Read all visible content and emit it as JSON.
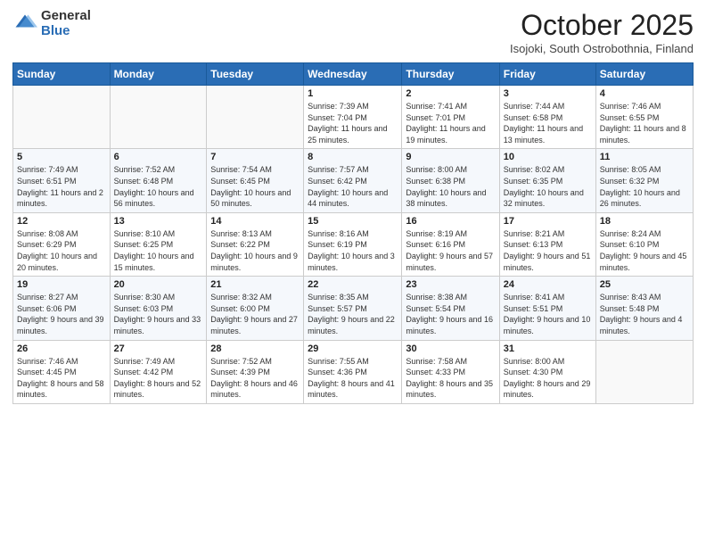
{
  "logo": {
    "general": "General",
    "blue": "Blue"
  },
  "header": {
    "month": "October 2025",
    "location": "Isojoki, South Ostrobothnia, Finland"
  },
  "weekdays": [
    "Sunday",
    "Monday",
    "Tuesday",
    "Wednesday",
    "Thursday",
    "Friday",
    "Saturday"
  ],
  "weeks": [
    [
      {
        "day": "",
        "sunrise": "",
        "sunset": "",
        "daylight": ""
      },
      {
        "day": "",
        "sunrise": "",
        "sunset": "",
        "daylight": ""
      },
      {
        "day": "",
        "sunrise": "",
        "sunset": "",
        "daylight": ""
      },
      {
        "day": "1",
        "sunrise": "Sunrise: 7:39 AM",
        "sunset": "Sunset: 7:04 PM",
        "daylight": "Daylight: 11 hours and 25 minutes."
      },
      {
        "day": "2",
        "sunrise": "Sunrise: 7:41 AM",
        "sunset": "Sunset: 7:01 PM",
        "daylight": "Daylight: 11 hours and 19 minutes."
      },
      {
        "day": "3",
        "sunrise": "Sunrise: 7:44 AM",
        "sunset": "Sunset: 6:58 PM",
        "daylight": "Daylight: 11 hours and 13 minutes."
      },
      {
        "day": "4",
        "sunrise": "Sunrise: 7:46 AM",
        "sunset": "Sunset: 6:55 PM",
        "daylight": "Daylight: 11 hours and 8 minutes."
      }
    ],
    [
      {
        "day": "5",
        "sunrise": "Sunrise: 7:49 AM",
        "sunset": "Sunset: 6:51 PM",
        "daylight": "Daylight: 11 hours and 2 minutes."
      },
      {
        "day": "6",
        "sunrise": "Sunrise: 7:52 AM",
        "sunset": "Sunset: 6:48 PM",
        "daylight": "Daylight: 10 hours and 56 minutes."
      },
      {
        "day": "7",
        "sunrise": "Sunrise: 7:54 AM",
        "sunset": "Sunset: 6:45 PM",
        "daylight": "Daylight: 10 hours and 50 minutes."
      },
      {
        "day": "8",
        "sunrise": "Sunrise: 7:57 AM",
        "sunset": "Sunset: 6:42 PM",
        "daylight": "Daylight: 10 hours and 44 minutes."
      },
      {
        "day": "9",
        "sunrise": "Sunrise: 8:00 AM",
        "sunset": "Sunset: 6:38 PM",
        "daylight": "Daylight: 10 hours and 38 minutes."
      },
      {
        "day": "10",
        "sunrise": "Sunrise: 8:02 AM",
        "sunset": "Sunset: 6:35 PM",
        "daylight": "Daylight: 10 hours and 32 minutes."
      },
      {
        "day": "11",
        "sunrise": "Sunrise: 8:05 AM",
        "sunset": "Sunset: 6:32 PM",
        "daylight": "Daylight: 10 hours and 26 minutes."
      }
    ],
    [
      {
        "day": "12",
        "sunrise": "Sunrise: 8:08 AM",
        "sunset": "Sunset: 6:29 PM",
        "daylight": "Daylight: 10 hours and 20 minutes."
      },
      {
        "day": "13",
        "sunrise": "Sunrise: 8:10 AM",
        "sunset": "Sunset: 6:25 PM",
        "daylight": "Daylight: 10 hours and 15 minutes."
      },
      {
        "day": "14",
        "sunrise": "Sunrise: 8:13 AM",
        "sunset": "Sunset: 6:22 PM",
        "daylight": "Daylight: 10 hours and 9 minutes."
      },
      {
        "day": "15",
        "sunrise": "Sunrise: 8:16 AM",
        "sunset": "Sunset: 6:19 PM",
        "daylight": "Daylight: 10 hours and 3 minutes."
      },
      {
        "day": "16",
        "sunrise": "Sunrise: 8:19 AM",
        "sunset": "Sunset: 6:16 PM",
        "daylight": "Daylight: 9 hours and 57 minutes."
      },
      {
        "day": "17",
        "sunrise": "Sunrise: 8:21 AM",
        "sunset": "Sunset: 6:13 PM",
        "daylight": "Daylight: 9 hours and 51 minutes."
      },
      {
        "day": "18",
        "sunrise": "Sunrise: 8:24 AM",
        "sunset": "Sunset: 6:10 PM",
        "daylight": "Daylight: 9 hours and 45 minutes."
      }
    ],
    [
      {
        "day": "19",
        "sunrise": "Sunrise: 8:27 AM",
        "sunset": "Sunset: 6:06 PM",
        "daylight": "Daylight: 9 hours and 39 minutes."
      },
      {
        "day": "20",
        "sunrise": "Sunrise: 8:30 AM",
        "sunset": "Sunset: 6:03 PM",
        "daylight": "Daylight: 9 hours and 33 minutes."
      },
      {
        "day": "21",
        "sunrise": "Sunrise: 8:32 AM",
        "sunset": "Sunset: 6:00 PM",
        "daylight": "Daylight: 9 hours and 27 minutes."
      },
      {
        "day": "22",
        "sunrise": "Sunrise: 8:35 AM",
        "sunset": "Sunset: 5:57 PM",
        "daylight": "Daylight: 9 hours and 22 minutes."
      },
      {
        "day": "23",
        "sunrise": "Sunrise: 8:38 AM",
        "sunset": "Sunset: 5:54 PM",
        "daylight": "Daylight: 9 hours and 16 minutes."
      },
      {
        "day": "24",
        "sunrise": "Sunrise: 8:41 AM",
        "sunset": "Sunset: 5:51 PM",
        "daylight": "Daylight: 9 hours and 10 minutes."
      },
      {
        "day": "25",
        "sunrise": "Sunrise: 8:43 AM",
        "sunset": "Sunset: 5:48 PM",
        "daylight": "Daylight: 9 hours and 4 minutes."
      }
    ],
    [
      {
        "day": "26",
        "sunrise": "Sunrise: 7:46 AM",
        "sunset": "Sunset: 4:45 PM",
        "daylight": "Daylight: 8 hours and 58 minutes."
      },
      {
        "day": "27",
        "sunrise": "Sunrise: 7:49 AM",
        "sunset": "Sunset: 4:42 PM",
        "daylight": "Daylight: 8 hours and 52 minutes."
      },
      {
        "day": "28",
        "sunrise": "Sunrise: 7:52 AM",
        "sunset": "Sunset: 4:39 PM",
        "daylight": "Daylight: 8 hours and 46 minutes."
      },
      {
        "day": "29",
        "sunrise": "Sunrise: 7:55 AM",
        "sunset": "Sunset: 4:36 PM",
        "daylight": "Daylight: 8 hours and 41 minutes."
      },
      {
        "day": "30",
        "sunrise": "Sunrise: 7:58 AM",
        "sunset": "Sunset: 4:33 PM",
        "daylight": "Daylight: 8 hours and 35 minutes."
      },
      {
        "day": "31",
        "sunrise": "Sunrise: 8:00 AM",
        "sunset": "Sunset: 4:30 PM",
        "daylight": "Daylight: 8 hours and 29 minutes."
      },
      {
        "day": "",
        "sunrise": "",
        "sunset": "",
        "daylight": ""
      }
    ]
  ]
}
